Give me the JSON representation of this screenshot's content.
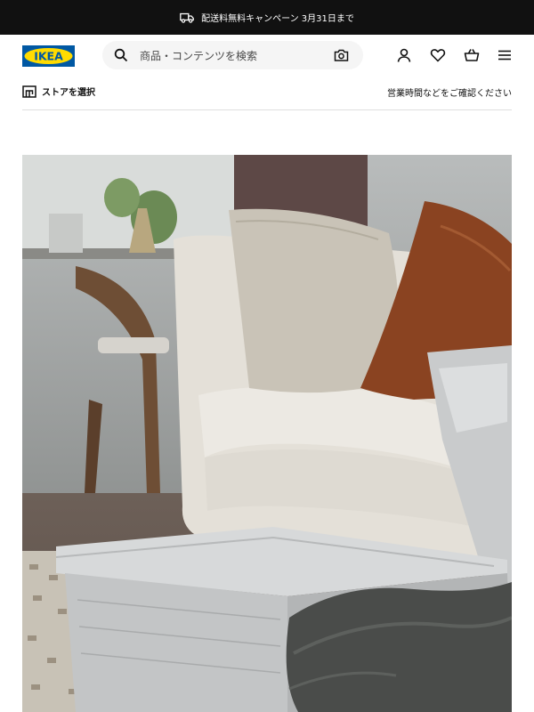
{
  "promo": {
    "icon": "truck-icon",
    "text": "配送料無料キャンペーン 3月31日まで"
  },
  "header": {
    "logo_text": "IKEA",
    "logo_colors": {
      "blue": "#0058A3",
      "yellow": "#FFDB00"
    },
    "search_placeholder": "商品・コンテンツを検索",
    "icons": [
      "search-icon",
      "camera-icon",
      "user-icon",
      "heart-icon",
      "cart-icon",
      "menu-icon"
    ]
  },
  "store": {
    "select_label": "ストアを選択",
    "hours_label": "営業時間などをご確認ください"
  },
  "hero": {
    "description": "",
    "colors": {
      "sofa": "#e4e0d8",
      "cushion_orange": "#8a4321",
      "box_grey": "#c9cbcc"
    }
  }
}
